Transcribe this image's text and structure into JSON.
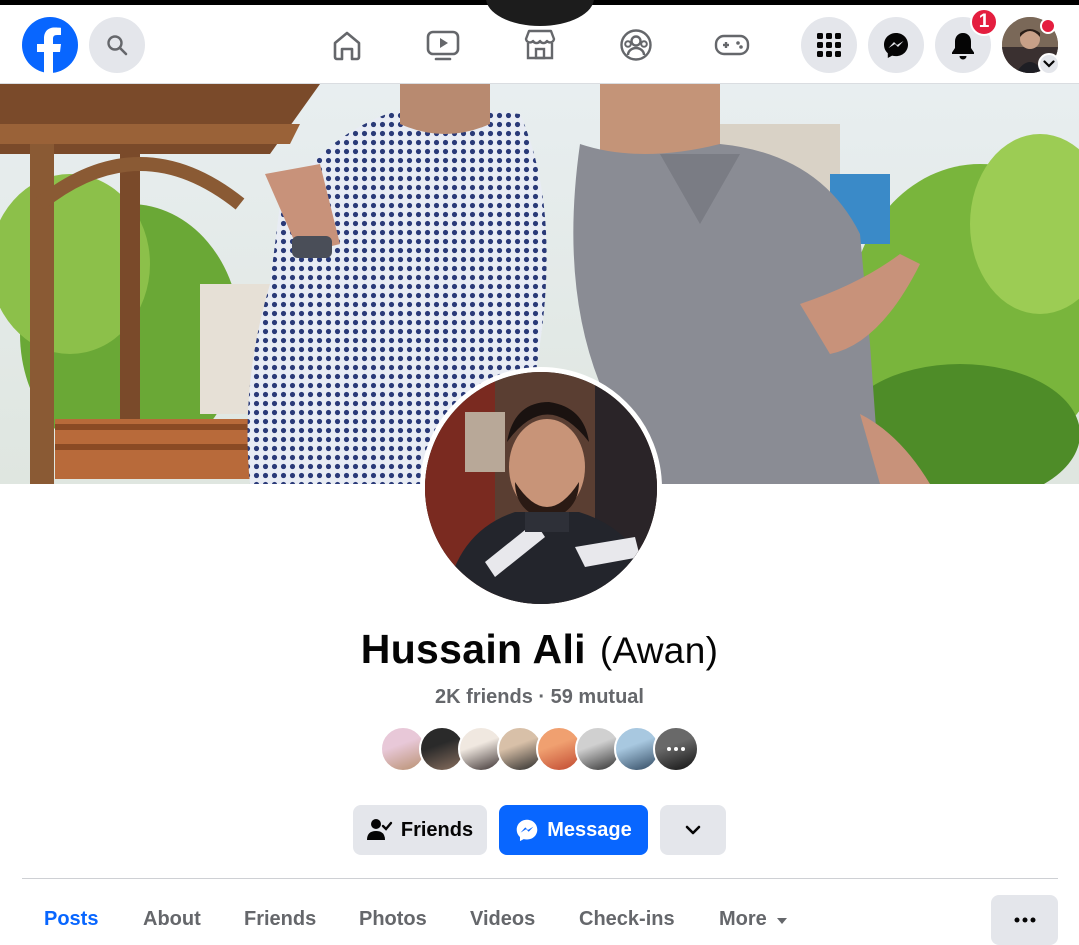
{
  "header": {
    "unread_notifications": "1"
  },
  "profile": {
    "name": "Hussain Ali",
    "alternate_name": "(Awan)",
    "friends_summary": "2K friends · 59 mutual"
  },
  "mutual_friends": [
    {
      "name": "mutual-friend-1",
      "colors": [
        "#e8c8d8",
        "#b89070"
      ]
    },
    {
      "name": "mutual-friend-2",
      "colors": [
        "#2a2a2a",
        "#8a7060"
      ]
    },
    {
      "name": "mutual-friend-3",
      "colors": [
        "#f0e8e0",
        "#3a3030"
      ]
    },
    {
      "name": "mutual-friend-4",
      "colors": [
        "#d8c0a8",
        "#2a2a2a"
      ]
    },
    {
      "name": "mutual-friend-5",
      "colors": [
        "#f0a070",
        "#c04830"
      ]
    },
    {
      "name": "mutual-friend-6",
      "colors": [
        "#d0d0d0",
        "#303030"
      ]
    },
    {
      "name": "mutual-friend-7",
      "colors": [
        "#a8c8e0",
        "#304860"
      ]
    },
    {
      "name": "mutual-friend-8",
      "colors": [
        "#c0c0c0",
        "#202020"
      ]
    }
  ],
  "actions": {
    "friends_label": "Friends",
    "message_label": "Message"
  },
  "tabs": [
    {
      "label": "Posts",
      "active": true
    },
    {
      "label": "About",
      "active": false
    },
    {
      "label": "Friends",
      "active": false
    },
    {
      "label": "Photos",
      "active": false
    },
    {
      "label": "Videos",
      "active": false
    },
    {
      "label": "Check-ins",
      "active": false
    },
    {
      "label": "More",
      "active": false
    }
  ],
  "colors": {
    "brand_blue": "#0866ff",
    "badge_red": "#e41e3f",
    "secondary_text": "#65676b",
    "button_gray": "#e4e6eb"
  },
  "icons": [
    "facebook-logo",
    "search-icon",
    "home-icon",
    "video-icon",
    "marketplace-icon",
    "groups-icon",
    "gaming-icon",
    "menu-grid-icon",
    "messenger-icon",
    "bell-icon",
    "chevron-down-icon",
    "add-friend-check-icon",
    "more-dots-icon",
    "caret-down-icon"
  ]
}
